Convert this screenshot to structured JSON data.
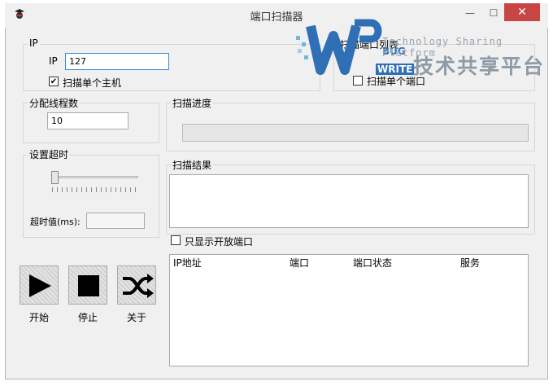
{
  "window": {
    "title": "端口扫描器",
    "min_label": "—",
    "max_label": "☐",
    "close_label": "✕"
  },
  "ip_group": {
    "title": "IP",
    "ip_label": "IP",
    "ip_value": "127",
    "single_host_label": "扫描单个主机",
    "single_host_checked": true
  },
  "port_group": {
    "title": "扫描端口列表",
    "single_port_label": "扫描单个端口",
    "single_port_checked": false
  },
  "threads": {
    "title": "分配线程数",
    "value": "10"
  },
  "timeout": {
    "title": "设置超时",
    "value_label": "超时值(ms):",
    "value": ""
  },
  "progress": {
    "title": "扫描进度",
    "percent": 0
  },
  "results": {
    "title": "扫描结果",
    "text": "",
    "open_only_label": "只显示开放端口",
    "open_only_checked": false
  },
  "table": {
    "columns": [
      "IP地址",
      "端口",
      "端口状态",
      "服务"
    ]
  },
  "buttons": {
    "start": "开始",
    "stop": "停止",
    "about": "关于"
  },
  "watermark": {
    "brand_top": "BUG",
    "brand_bottom": "WRITE",
    "tagline": "Technology Sharing Platform",
    "cn_text": "技术共享平台"
  },
  "colors": {
    "close_button": "#c74545",
    "focus_border": "#3a8ad8",
    "watermark_blue": "#2f6fb5"
  }
}
